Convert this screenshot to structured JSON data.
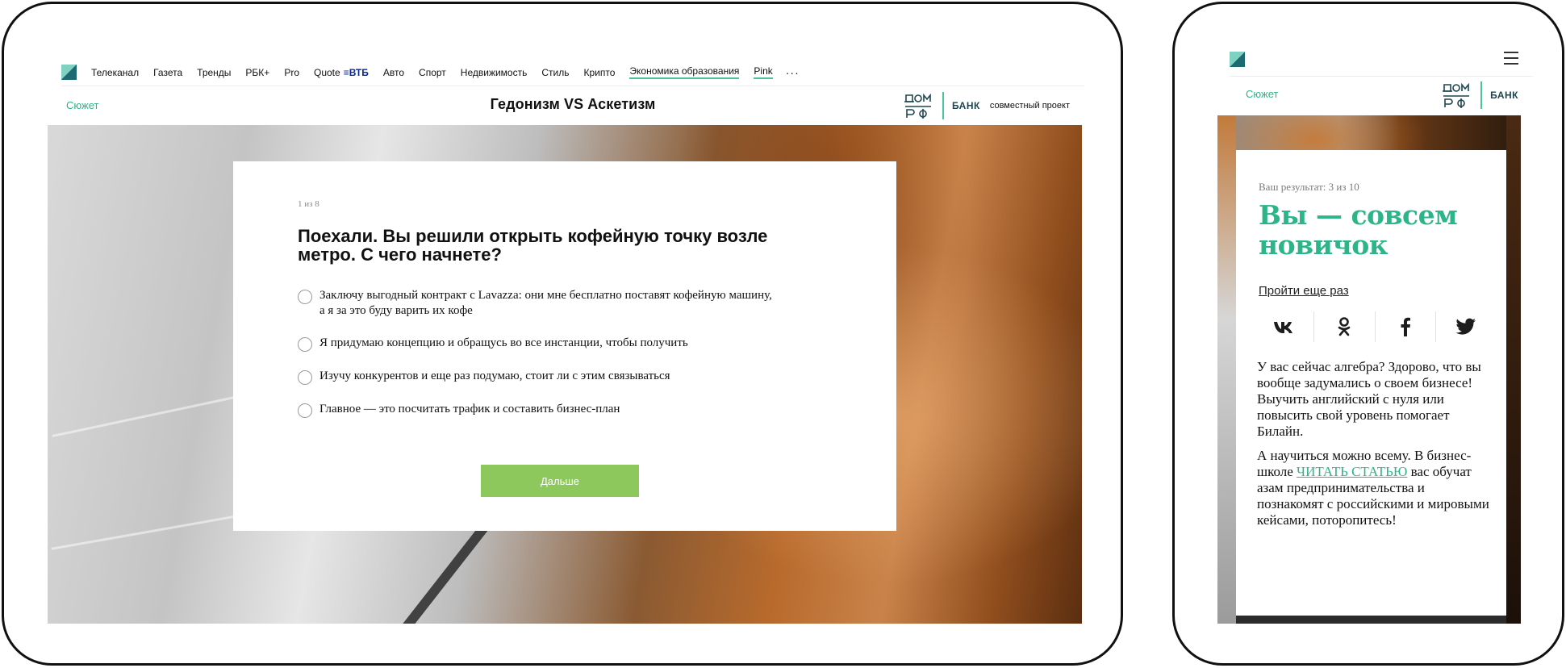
{
  "desktop": {
    "nav": {
      "items": [
        "Телеканал",
        "Газета",
        "Тренды",
        "РБК+",
        "Pro",
        "Quote",
        "Авто",
        "Спорт",
        "Недвижимость",
        "Стиль",
        "Крипто",
        "Экономика образования",
        "Pink"
      ],
      "quote_badge": "ВТБ",
      "more": "···"
    },
    "subhead": {
      "section_link": "Сюжет",
      "title": "Гедонизм VS Аскетизм",
      "partner_bank": "БАНК",
      "partner_note": "совместный проект"
    },
    "quiz": {
      "counter": "1 из 8",
      "question": "Поехали. Вы решили открыть кофейную точку возле метро. С чего начнете?",
      "options": [
        "Заключу выгодный контракт с Lavazza: они мне бесплатно поставят кофейную машину, а я за это буду варить их кофе",
        "Я придумаю концепцию и обращусь во все инстанции, чтобы получить",
        "Изучу конкурентов и еще раз подумаю, стоит ли с этим связываться",
        "Главное — это посчитать трафик и составить бизнес-план"
      ],
      "next_button": "Дальше"
    }
  },
  "mobile": {
    "subhead": {
      "section_link": "Сюжет",
      "partner_bank": "БАНК"
    },
    "result": {
      "score": "Ваш результат: 3 из 10",
      "heading": "Вы — совсем новичок",
      "retry": "Пройти еще раз",
      "share": [
        "vk-icon",
        "odnoklassniki-icon",
        "facebook-icon",
        "twitter-icon"
      ],
      "paragraph1": "У вас сейчас алгебра? Здорово, что вы вообще задумались о своем бизнесе! Выучить английский с нуля или повысить свой уровень помогает Билайн.",
      "paragraph2_before": "А научиться можно всему. В бизнес-школе ",
      "paragraph2_link": "ЧИТАТЬ СТАТЬЮ",
      "paragraph2_after": " вас обучат азам предпринимательства и познакомят с российскими и мировыми кейсами, поторопитесь!"
    }
  },
  "colors": {
    "accent_green": "#2bb589",
    "button_green": "#8cc85b",
    "underline_green": "#4cc49b",
    "vtb_blue": "#0a2896"
  }
}
